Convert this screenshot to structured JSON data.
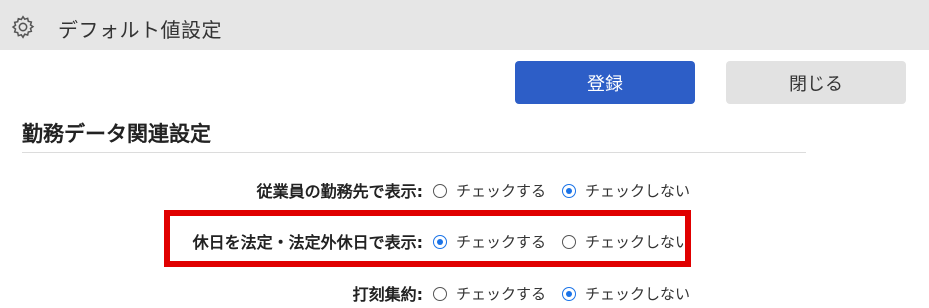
{
  "titlebar": {
    "title": "デフォルト値設定",
    "icon": "gear-icon"
  },
  "buttons": {
    "register": "登録",
    "close": "閉じる"
  },
  "colors": {
    "primary": "#2d5ec7",
    "highlight": "#e00000",
    "radio": "#1a73e8"
  },
  "section": {
    "title": "勤務データ関連設定"
  },
  "rows": [
    {
      "label": "従業員の勤務先で表示:",
      "option_check": "チェックする",
      "option_uncheck": "チェックしない",
      "selected": "チェックしない"
    },
    {
      "label": "休日を法定・法定外休日で表示:",
      "option_check": "チェックする",
      "option_uncheck": "チェックしない",
      "selected": "チェックする"
    },
    {
      "label": "打刻集約:",
      "option_check": "チェックする",
      "option_uncheck": "チェックしない",
      "selected": "チェックしない"
    }
  ]
}
